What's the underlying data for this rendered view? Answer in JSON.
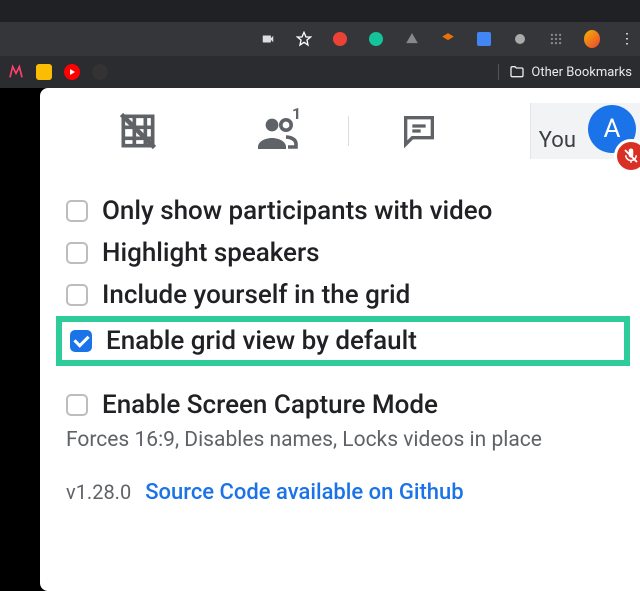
{
  "chrome": {
    "other_bookmarks": "Other Bookmarks"
  },
  "meet": {
    "you_label": "You",
    "avatar_initial": "A"
  },
  "options": [
    {
      "key": "only_video",
      "label": "Only show participants with video",
      "checked": false
    },
    {
      "key": "highlight_speakers",
      "label": "Highlight speakers",
      "checked": false
    },
    {
      "key": "include_self",
      "label": "Include yourself in the grid",
      "checked": false
    },
    {
      "key": "enable_default",
      "label": "Enable grid view by default",
      "checked": true,
      "highlighted": true
    }
  ],
  "capture": {
    "label": "Enable Screen Capture Mode",
    "desc": "Forces 16:9, Disables names, Locks videos in place"
  },
  "footer": {
    "version": "v1.28.0",
    "link": "Source Code available on Github"
  }
}
